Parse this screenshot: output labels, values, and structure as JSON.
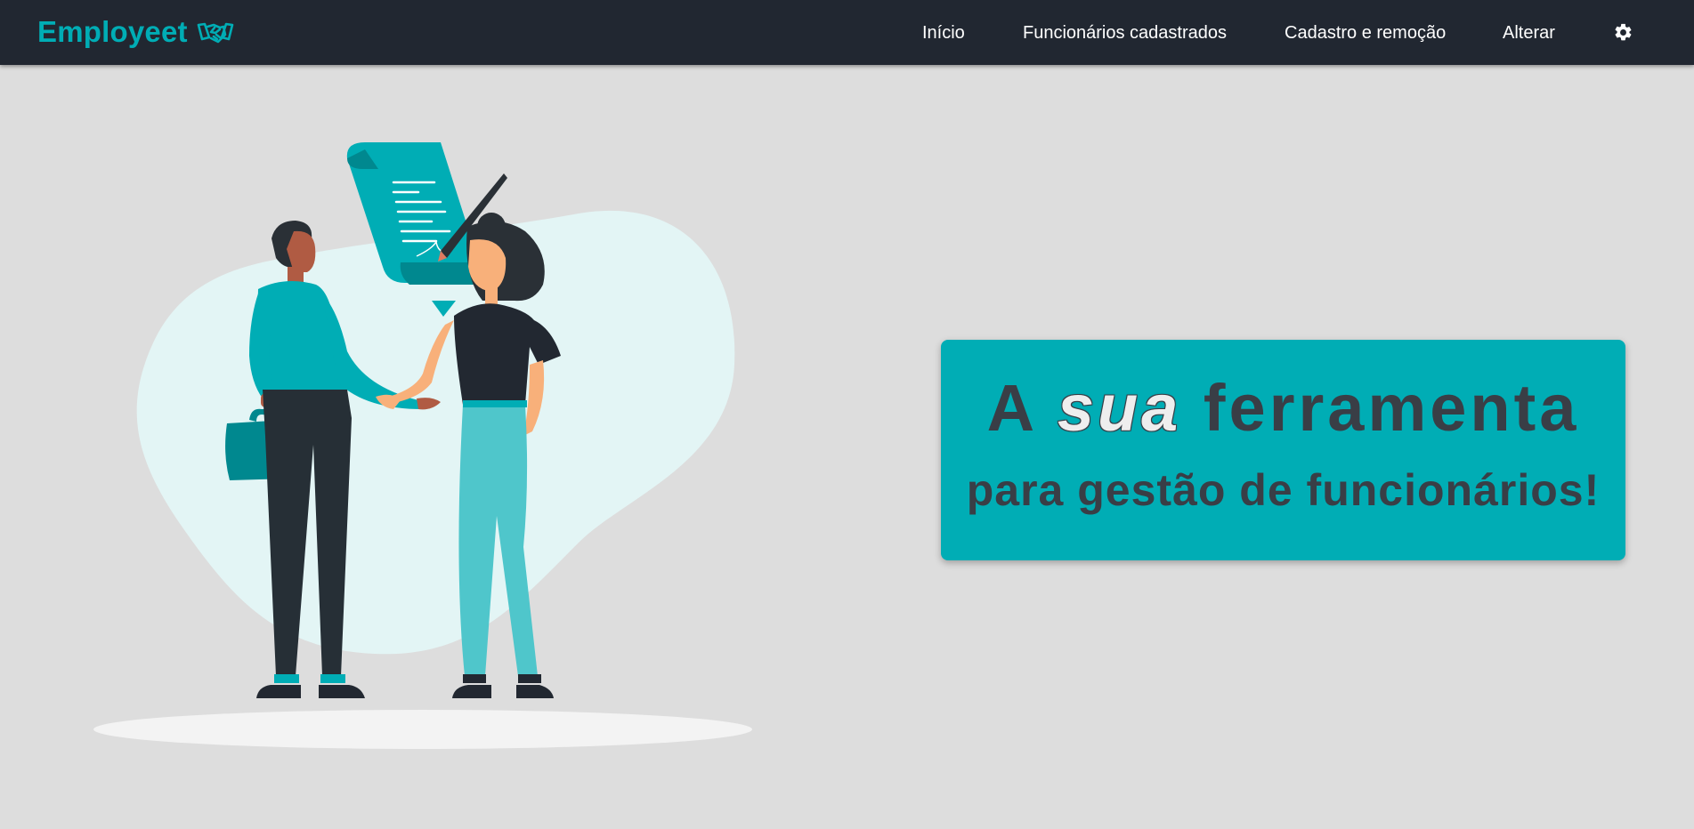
{
  "header": {
    "brand": "Employeet",
    "brand_icon": "handshake-icon",
    "nav": {
      "inicio": "Início",
      "funcionarios": "Funcionários cadastrados",
      "cadastro": "Cadastro e remoção",
      "alterar": "Alterar"
    },
    "settings_icon": "gear-icon"
  },
  "hero": {
    "word_a": "A",
    "word_sua": "sua",
    "word_ferramenta": "ferramenta",
    "subtitle": "para gestão de funcionários!"
  },
  "colors": {
    "accent": "#00adb5",
    "navbar": "#212731",
    "background": "#dddddd",
    "text_dark": "#393e46",
    "text_light": "#eeeeee"
  }
}
